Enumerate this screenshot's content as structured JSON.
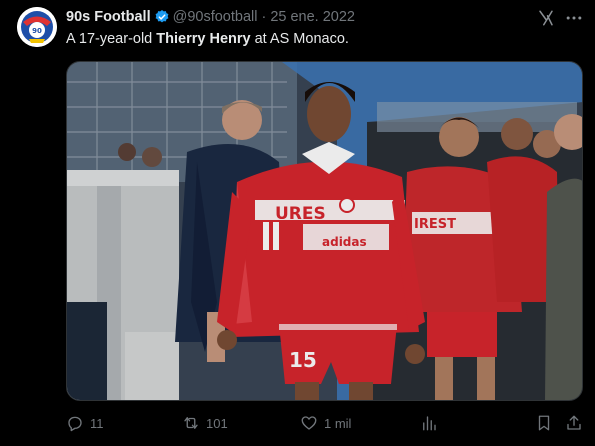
{
  "tweet": {
    "author": {
      "display_name": "90s Football",
      "handle": "@90sfootball",
      "verified": true,
      "avatar_icon": "90s-football-logo-icon"
    },
    "separator": "·",
    "timestamp": "25 ene. 2022",
    "text_parts": {
      "part1": "A 17-year-old ",
      "bold1": "Thierry Henry",
      "part2": " at AS Monaco."
    },
    "image": {
      "description_icon": "photo",
      "kit_text_left": "URES",
      "kit_text_left_b": "URESI",
      "kit_text_right": "IREST",
      "kit_sponsor": "adidas",
      "shorts_number": "15"
    },
    "actions": {
      "replies": "11",
      "reposts": "101",
      "likes": "1 mil"
    }
  },
  "colors": {
    "background": "#000000",
    "text_primary": "#e7e9ea",
    "text_secondary": "#71767b",
    "verified_blue": "#1d9bf0",
    "kit_red": "#d8262e"
  }
}
